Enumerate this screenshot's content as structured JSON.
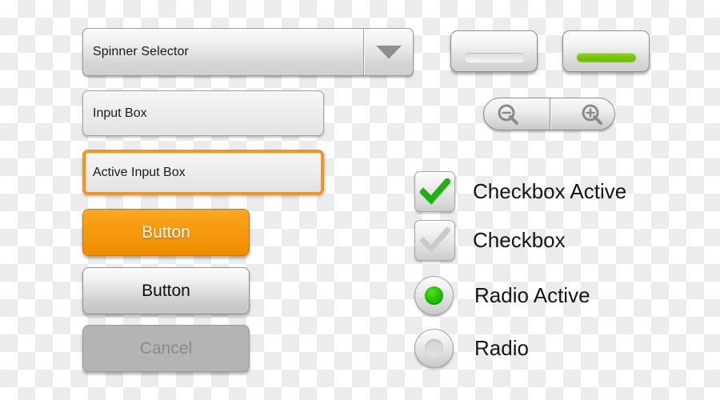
{
  "spinner": {
    "label": "Spinner Selector",
    "arrow_icon": "chevron-down-icon"
  },
  "inputs": {
    "normal": {
      "value": "Input Box"
    },
    "active": {
      "value": "Active Input Box",
      "focus_color": "#f39424"
    }
  },
  "buttons": {
    "primary": {
      "label": "Button",
      "color_top": "#f9a825",
      "color_bottom": "#f08c00"
    },
    "secondary": {
      "label": "Button"
    },
    "cancel": {
      "label": "Cancel"
    }
  },
  "toggles": {
    "off": {
      "state": "off",
      "bar_color": "#e6e6e6"
    },
    "on": {
      "state": "on",
      "bar_color": "#77c507"
    }
  },
  "zoom_control": {
    "out_icon": "magnifier-minus-icon",
    "in_icon": "magnifier-plus-icon"
  },
  "checkboxes": [
    {
      "label": "Checkbox Active",
      "checked": true,
      "check_color": "#22b014"
    },
    {
      "label": "Checkbox",
      "checked": false,
      "check_color": "#c9c9c9"
    }
  ],
  "radios": [
    {
      "label": "Radio Active",
      "selected": true,
      "dot_color": "#19c000"
    },
    {
      "label": "Radio",
      "selected": false,
      "dot_color": "#d8d8d8"
    }
  ]
}
